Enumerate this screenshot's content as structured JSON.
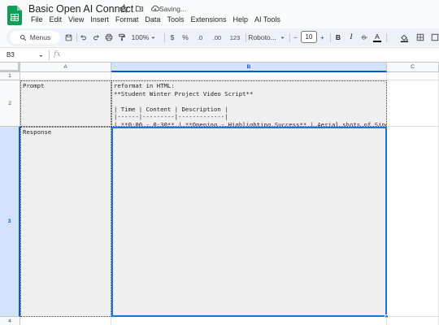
{
  "app": {
    "title": "Basic Open AI Connect",
    "status": "Saving...",
    "brand_color": "#0f9d58",
    "accent_color": "#1a73e8"
  },
  "menu": [
    "File",
    "Edit",
    "View",
    "Insert",
    "Format",
    "Data",
    "Tools",
    "Extensions",
    "Help",
    "AI Tools"
  ],
  "toolbar": {
    "menus_label": "Menus",
    "zoom": "100%",
    "currency": "$",
    "percent": "%",
    "decrease_decimals": ".0",
    "increase_decimals": ".00",
    "number_format": "123",
    "font": "Roboto...",
    "font_size": "10",
    "bold": "B",
    "italic": "I",
    "text_color": "A",
    "minus": "−",
    "plus": "+"
  },
  "formula_bar": {
    "name_box": "B3",
    "fx": "fx"
  },
  "grid": {
    "columns": [
      "A",
      "B",
      "C"
    ],
    "selected_column": "B",
    "rows": [
      "1",
      "2",
      "3",
      "4"
    ],
    "selected_row": "3",
    "cells": {
      "A2": "Prompt",
      "A3": "Response",
      "B2": "reformat in HTML:\n**Student Winter Project Video Script**\n\n| Time | Content | Description |\n|------|---------|-------------|\n| **0:00 - 0:30** | **Opening - Highlighting Success** | Aerial shots of Singa"
    }
  }
}
